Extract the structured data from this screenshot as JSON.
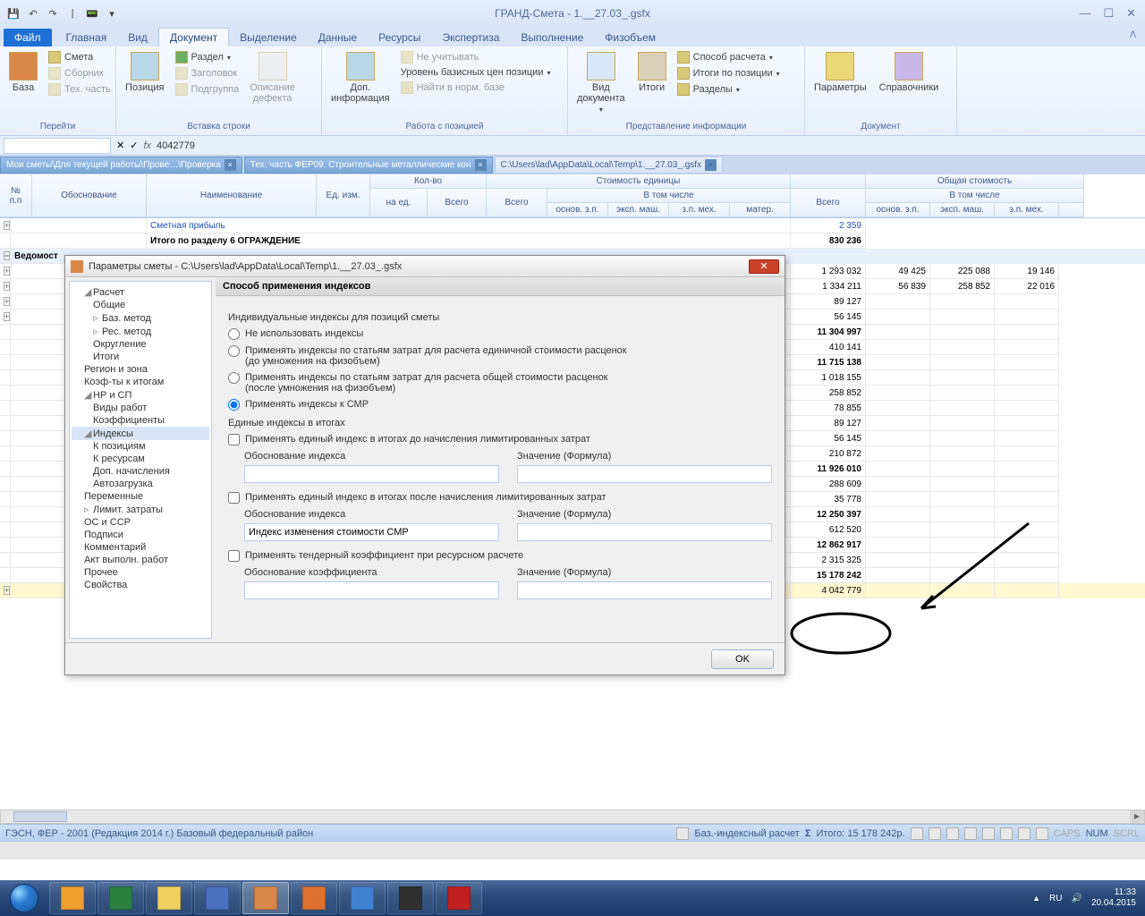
{
  "title": "ГРАНД-Смета - 1.__27.03_.gsfx",
  "ribbon": {
    "file": "Файл",
    "tabs": [
      "Главная",
      "Вид",
      "Документ",
      "Выделение",
      "Данные",
      "Ресурсы",
      "Экспертиза",
      "Выполнение",
      "Физобъем"
    ],
    "active_tab": 2,
    "groups": {
      "g1": {
        "label": "Перейти",
        "btn1": "База",
        "i1": "Смета",
        "i2": "Сборник",
        "i3": "Тех. часть"
      },
      "g2": {
        "label": "Вставка строки",
        "btn1": "Позиция",
        "btn2": "Раздел",
        "i1": "Заголовок",
        "i2": "Подгруппа",
        "btn3": "Описание\nдефекта"
      },
      "g3": {
        "label": "Работа с позицией",
        "btn1": "Доп.\nинформация",
        "i1": "Не учитывать",
        "i2": "Уровень базисных цен позиции",
        "i3": "Найти в норм. базе"
      },
      "g4": {
        "label": "Представление информации",
        "btn1": "Вид\nдокумента",
        "btn2": "Итоги",
        "i1": "Способ расчета",
        "i2": "Итоги по позиции",
        "i3": "Разделы"
      },
      "g5": {
        "label": "Документ",
        "btn1": "Параметры",
        "btn2": "Справочники"
      }
    }
  },
  "formula": {
    "value": "4042779"
  },
  "doctabs": {
    "t1": "Мои сметы\\Для текущей работы\\Прове…\\Проверка",
    "t2": "Тех. часть ФЕР09. Строительные металлические кон",
    "t3": "C:\\Users\\lad\\AppData\\Local\\Temp\\1.__27.03_.gsfx"
  },
  "cols": {
    "c1": "№\nп.п",
    "c2": "Обоснование",
    "c3": "Наименование",
    "c4": "Ед. изм.",
    "c5": "Кол-во",
    "c5a": "на ед.",
    "c5b": "Всего",
    "c6": "Стоимость единицы",
    "c6a": "Всего",
    "c6b": "В том числе",
    "c6b1": "основ. з.п.",
    "c6b2": "эксп. маш.",
    "c6b3": "з.п. мех.",
    "c6b4": "матер.",
    "c7": "Всего",
    "c8": "Общая стоимость",
    "c8a": "В том числе",
    "c8a1": "основ. з.п.",
    "c8a2": "эксп. маш.",
    "c8a3": "з.п. мех."
  },
  "rows": {
    "r1": "Сметная прибыль",
    "r1v": "2 359",
    "r2": "Итого по разделу 6 ОГРАЖДЕНИЕ",
    "r2v": "830 236",
    "r3": "Ведомост",
    "vals": [
      "1 293 032",
      "1 334 211",
      "89 127",
      "56 145",
      "11 304 997",
      "410 141",
      "11 715 138",
      "1 018 155",
      "258 852",
      "78 855",
      "89 127",
      "56 145",
      "210 872",
      "11 926 010",
      "288 609",
      "35 778",
      "12 250 397",
      "612 520",
      "12 862 917",
      "2 315 325",
      "15 178 242",
      "4 042 779"
    ],
    "row0": {
      "c2": "49 425",
      "c3": "225 088",
      "c4": "19 146"
    },
    "row1": {
      "c2": "56 839",
      "c3": "258 852",
      "c4": "22 016"
    }
  },
  "dialog": {
    "title": "Параметры сметы - C:\\Users\\lad\\AppData\\Local\\Temp\\1.__27.03_.gsfx",
    "tree": [
      "Расчет",
      "Общие",
      "Баз. метод",
      "Рес. метод",
      "Округление",
      "Итоги",
      "Регион и зона",
      "Коэф-ты к итогам",
      "НР и СП",
      "Виды работ",
      "Коэффициенты",
      "Индексы",
      "К позициям",
      "К ресурсам",
      "Доп. начисления",
      "Автозагрузка",
      "Переменные",
      "Лимит. затраты",
      "ОС и ССР",
      "Подписи",
      "Комментарий",
      "Акт выполн. работ",
      "Прочее",
      "Свойства"
    ],
    "header": "Способ применения индексов",
    "sub1": "Индивидуальные индексы для позиций сметы",
    "r1": "Не использовать индексы",
    "r2": "Применять индексы по статьям затрат для расчета единичной стоимости расценок\n(до умножения на физобъем)",
    "r3": "Применять индексы по статьям затрат для расчета общей стоимости расценок\n(после умножения на физобъем)",
    "r4": "Применять индексы к СМР",
    "sub2": "Единые индексы в итогах",
    "c1": "Применять единый индекс в итогах до начисления лимитированных затрат",
    "l1": "Обоснование индекса",
    "l2": "Значение (Формула)",
    "c2": "Применять единый индекс в итогах после начисления лимитированных затрат",
    "v2": "Индекс изменения стоимости СМР",
    "c3": "Применять тендерный коэффициент при ресурсном расчете",
    "l3": "Обоснование коэффициента",
    "ok": "OK"
  },
  "status": {
    "left": "ГЭСН, ФЕР - 2001 (Редакция 2014 г.)   Базовый федеральный район",
    "mode": "Баз.-индексный расчет",
    "sum": "Итого: 15 178 242р.",
    "caps": "CAPS",
    "num": "NUM",
    "scrl": "SCRL"
  },
  "tray": {
    "lang": "RU",
    "time": "11:33",
    "date": "20.04.2015"
  }
}
